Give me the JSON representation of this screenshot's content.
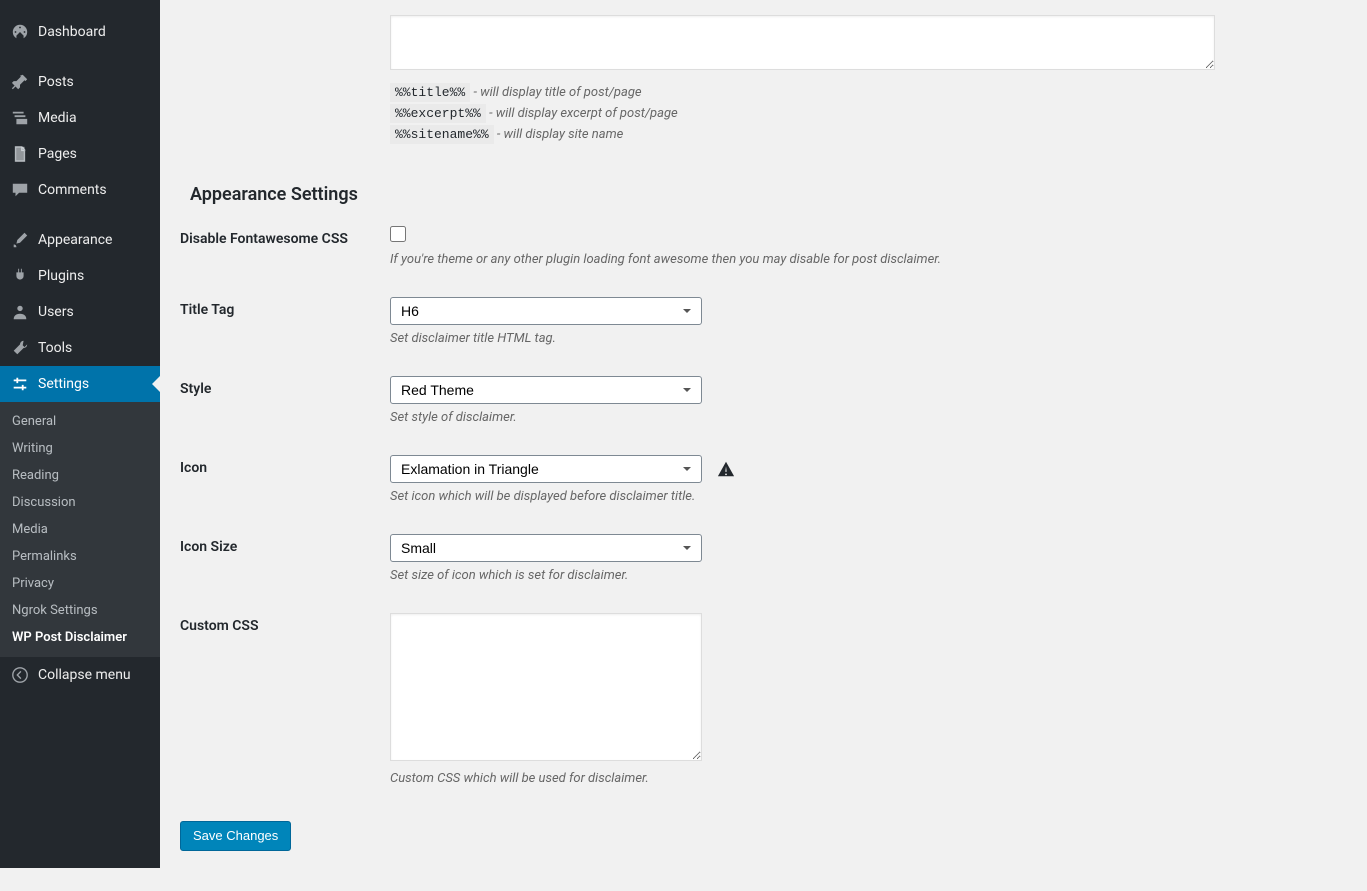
{
  "sidebar": {
    "items": [
      {
        "label": "Dashboard",
        "icon": "dashboard"
      },
      {
        "label": "Posts",
        "icon": "pin"
      },
      {
        "label": "Media",
        "icon": "media"
      },
      {
        "label": "Pages",
        "icon": "pages"
      },
      {
        "label": "Comments",
        "icon": "comment"
      },
      {
        "label": "Appearance",
        "icon": "brush"
      },
      {
        "label": "Plugins",
        "icon": "plug"
      },
      {
        "label": "Users",
        "icon": "user"
      },
      {
        "label": "Tools",
        "icon": "wrench"
      },
      {
        "label": "Settings",
        "icon": "sliders"
      }
    ],
    "submenu": [
      "General",
      "Writing",
      "Reading",
      "Discussion",
      "Media",
      "Permalinks",
      "Privacy",
      "Ngrok Settings",
      "WP Post Disclaimer"
    ],
    "collapse": "Collapse menu"
  },
  "placeholders": {
    "p1_code": "%%title%%",
    "p1_desc": " - will display title of post/page",
    "p2_code": "%%excerpt%%",
    "p2_desc": " - will display excerpt of post/page",
    "p3_code": "%%sitename%%",
    "p3_desc": " - will display site name"
  },
  "section_heading": "Appearance Settings",
  "fields": {
    "disable_fa": {
      "label": "Disable Fontawesome CSS",
      "help": "If you're theme or any other plugin loading font awesome then you may disable for post disclaimer."
    },
    "title_tag": {
      "label": "Title Tag",
      "value": "H6",
      "help": "Set disclaimer title HTML tag."
    },
    "style": {
      "label": "Style",
      "value": "Red Theme",
      "help": "Set style of disclaimer."
    },
    "icon": {
      "label": "Icon",
      "value": "Exlamation in Triangle",
      "help": "Set icon which will be displayed before disclaimer title."
    },
    "icon_size": {
      "label": "Icon Size",
      "value": "Small",
      "help": "Set size of icon which is set for disclaimer."
    },
    "custom_css": {
      "label": "Custom CSS",
      "help": "Custom CSS which will be used for disclaimer."
    }
  },
  "submit_label": "Save Changes"
}
